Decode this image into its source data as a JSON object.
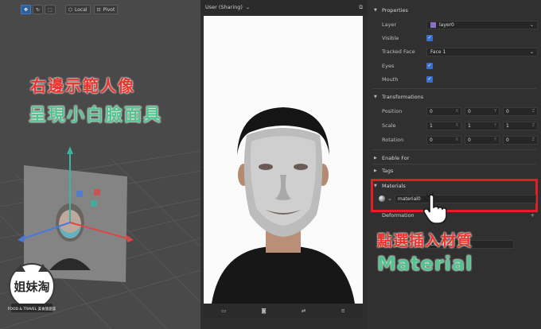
{
  "toolbar": {
    "local_label": "Local",
    "pivot_label": "Pivot"
  },
  "viewport_overlay": {
    "line1": "右邊示範人像",
    "line2": "呈現小白臉面具"
  },
  "logo": {
    "main": "姐妹淘",
    "sub": "FOOD & TRAVEL 美食旅遊誌"
  },
  "preview": {
    "camera_label": "User (Sharing)",
    "icons": [
      "video-icon",
      "camera-icon",
      "flip-camera-icon",
      "menu-icon"
    ]
  },
  "panel": {
    "properties_title": "Properties",
    "layer_label": "Layer",
    "layer_value": "layer0",
    "layer_color": "#8a6fc2",
    "visible_label": "Visible",
    "tracked_face_label": "Tracked Face",
    "tracked_face_value": "Face 1",
    "eyes_label": "Eyes",
    "mouth_label": "Mouth",
    "transformations_title": "Transformations",
    "position_label": "Position",
    "position_values": [
      "0",
      "0",
      "0"
    ],
    "scale_label": "Scale",
    "scale_values": [
      "1",
      "1",
      "1"
    ],
    "rotation_label": "Rotation",
    "rotation_values": [
      "0",
      "0",
      "0"
    ],
    "axes": [
      "X",
      "Y",
      "Z"
    ],
    "enable_for_title": "Enable For",
    "tags_title": "Tags",
    "materials_title": "Materials",
    "material_value": "material0",
    "deformation_title": "Deformation",
    "partial_row_label": "Combine"
  },
  "annotation": {
    "line1": "點選插入材質",
    "line2": "Material"
  },
  "colors": {
    "accent_blue": "#3b6fc9",
    "highlight_red": "#e11f26",
    "annotation_green": "#52c48f"
  }
}
